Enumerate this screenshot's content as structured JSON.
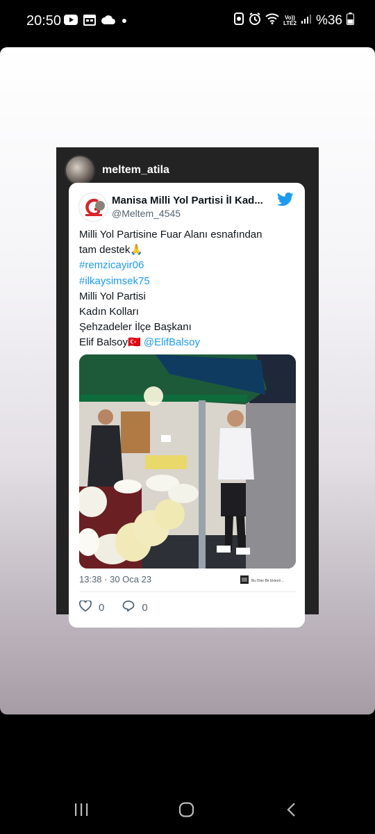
{
  "status_bar": {
    "time": "20:50",
    "battery": "%36",
    "left_icons": [
      "youtube-icon",
      "calendar-icon",
      "cloud-icon",
      "dot-icon"
    ],
    "right_icons": [
      "alarm-icon",
      "clock-icon",
      "wifi-icon",
      "volte-icon",
      "signal-icon",
      "battery-icon"
    ],
    "volte_label": "Vo))\nLTE2"
  },
  "story": {
    "username": "meltem_atila"
  },
  "tweet": {
    "display_name": "Manisa Milli Yol Partisi İl Kad...",
    "handle": "@Meltem_4545",
    "text_line1": "Milli Yol Partisine Fuar Alanı esnafından",
    "text_line2": "tam destek",
    "emoji_pray": "🙏",
    "hashtag1": "#remzicayir06",
    "hashtag2": "#ilkaysimsek75",
    "text_line5": "Milli Yol Partisi",
    "text_line6": "Kadın Kolları",
    "text_line7": "Şehzadeler İlçe Başkanı",
    "text_line8": "Elif Balsoy",
    "flag_emoji": "🇹🇷",
    "mention": "@ElifBalsoy",
    "timestamp": "13:38 · 30 Oca 23",
    "source_text": "Bu Olan Bir Eklenti ...",
    "likes": "0",
    "replies": "0"
  },
  "colors": {
    "twitter_blue": "#1d9bf0",
    "hashtag_blue": "#1d9bf0"
  }
}
